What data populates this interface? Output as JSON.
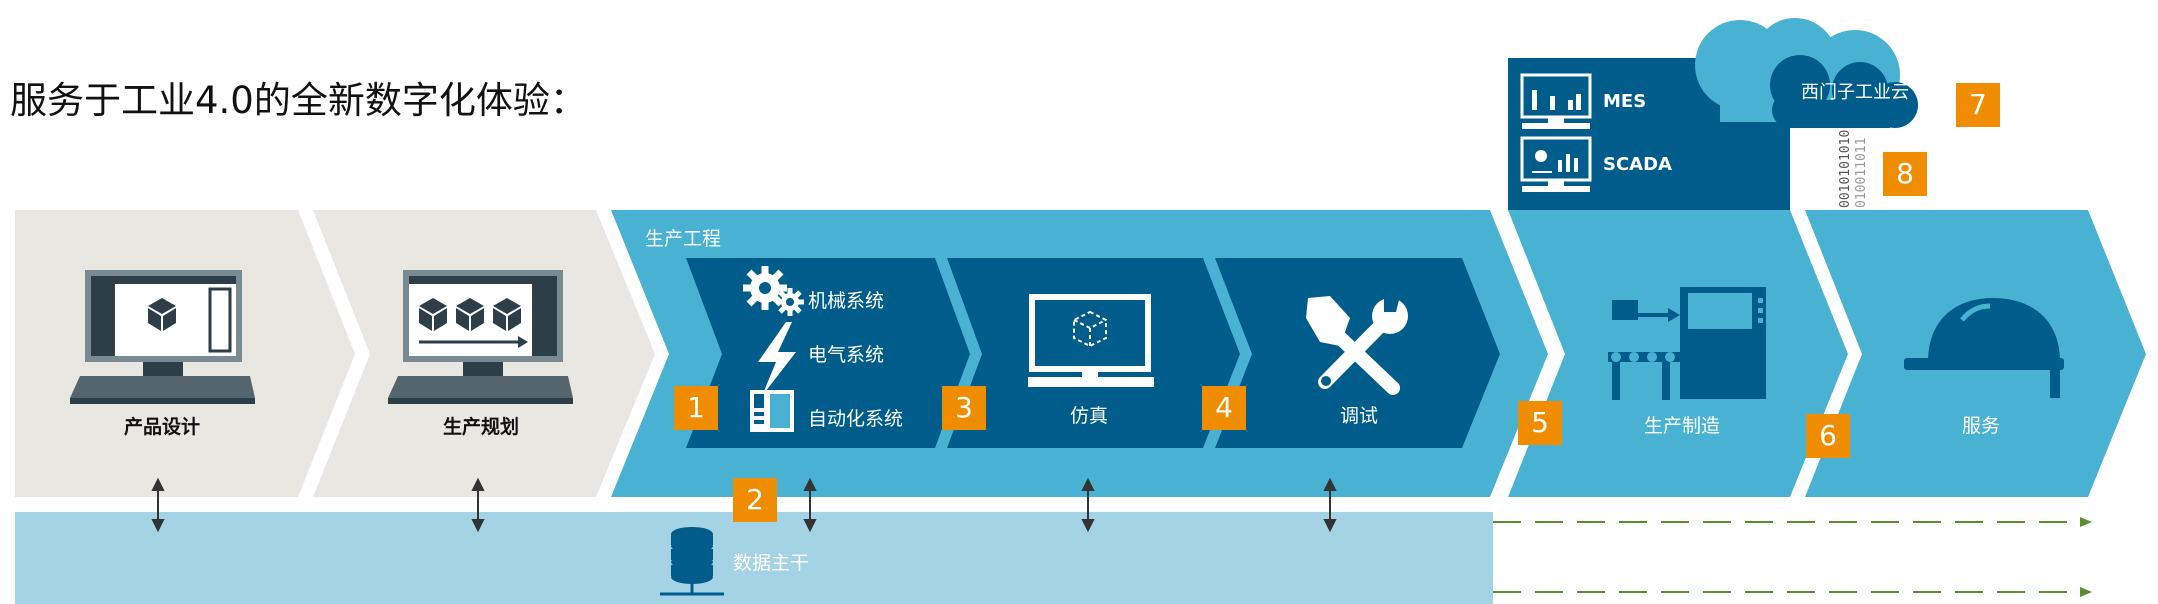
{
  "title": "服务于工业4.0的全新数字化体验：",
  "stages": {
    "product_design": "产品设计",
    "production_planning": "生产规划",
    "production_engineering": "生产工程",
    "mechanical_system": "机械系统",
    "electrical_system": "电气系统",
    "automation_system": "自动化系统",
    "simulation": "仿真",
    "commissioning": "调试",
    "production": "生产制造",
    "service": "服务"
  },
  "data_backbone": "数据主干",
  "mes": "MES",
  "scada": "SCADA",
  "cloud": "西门子工业云",
  "binary": [
    "0010101010",
    "010011011"
  ],
  "badges": [
    "1",
    "2",
    "3",
    "4",
    "5",
    "6",
    "7",
    "8"
  ],
  "colors": {
    "light_gray": "#e8e7e1",
    "light_blue": "#49b2d3",
    "dark_blue": "#005c8a",
    "pale_blue": "#a4d3e6",
    "orange": "#f08c00",
    "green": "#5e8c2e"
  }
}
